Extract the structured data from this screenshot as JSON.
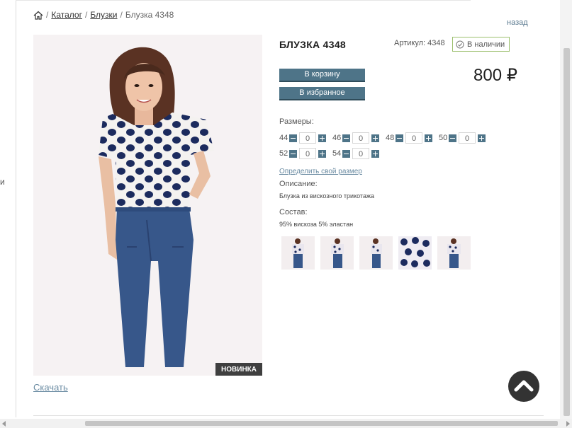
{
  "left_edge_char": "и",
  "breadcrumb": {
    "items": [
      {
        "label": "Каталог",
        "link": true
      },
      {
        "label": "Блузки",
        "link": true
      },
      {
        "label": "Блузка 4348",
        "link": false
      }
    ],
    "separator": "/"
  },
  "back_label": "назад",
  "product": {
    "title": "БЛУЗКА 4348",
    "sku": "Артикул: 4348",
    "stock": "В наличии",
    "price": "800 ₽",
    "badge": "НОВИНКА",
    "download_label": "Скачать"
  },
  "buttons": {
    "cart": "В корзину",
    "favorite": "В избранное"
  },
  "sizes": {
    "label": "Размеры:",
    "rows": [
      [
        {
          "size": "44",
          "qty": "0"
        },
        {
          "size": "46",
          "qty": "0"
        },
        {
          "size": "48",
          "qty": "0"
        },
        {
          "size": "50",
          "qty": "0"
        }
      ],
      [
        {
          "size": "52",
          "qty": "0"
        },
        {
          "size": "54",
          "qty": "0"
        }
      ]
    ],
    "help_link": "Определить свой размер"
  },
  "description": {
    "label": "Описание:",
    "text": "Блузка из вискозного трикотажа"
  },
  "composition": {
    "label": "Состав:",
    "text": "95% вискоза 5% эластан"
  },
  "thumbnail_count": 5,
  "colors": {
    "button": "#4e7488",
    "stock_border": "#9bbf6d",
    "link": "#6a8ba2",
    "badge_bg": "#3f3f3f"
  },
  "icons": {
    "home": "home-icon",
    "stock": "check-circle-icon",
    "scroll_top": "chevron-up-icon"
  }
}
